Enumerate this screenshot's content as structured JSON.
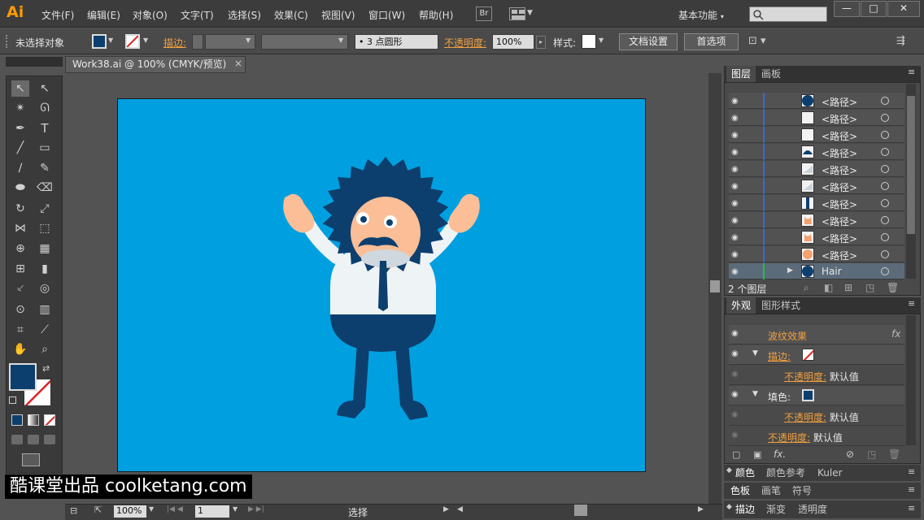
{
  "app": {
    "logo": "Ai"
  },
  "menu": [
    "文件(F)",
    "编辑(E)",
    "对象(O)",
    "文字(T)",
    "选择(S)",
    "效果(C)",
    "视图(V)",
    "窗口(W)",
    "帮助(H)"
  ],
  "bridge_button": "Br",
  "workspace": "基本功能",
  "window_controls": {
    "minimize": "—",
    "maximize": "□",
    "close": "✕"
  },
  "control_bar": {
    "selection_label": "未选择对象",
    "stroke_label": "描边:",
    "brush_value": "3 点圆形",
    "opacity_label": "不透明度:",
    "opacity_value": "100%",
    "style_label": "样式:",
    "doc_setup_button": "文档设置",
    "preferences_button": "首选项"
  },
  "document": {
    "tab_title": "Work38.ai @ 100% (CMYK/预览)",
    "close": "×"
  },
  "status": {
    "zoom": "100%",
    "page": "1",
    "tool": "选择"
  },
  "watermark": "酷课堂出品 coolketang.com",
  "layers_panel": {
    "tabs": [
      "图层",
      "画板"
    ],
    "rows": [
      {
        "name": "<路径>",
        "thumb": "navy-circle"
      },
      {
        "name": "<路径>",
        "thumb": "white"
      },
      {
        "name": "<路径>",
        "thumb": "white"
      },
      {
        "name": "<路径>",
        "thumb": "navy-dome"
      },
      {
        "name": "<路径>",
        "thumb": "white-curve"
      },
      {
        "name": "<路径>",
        "thumb": "white-curve"
      },
      {
        "name": "<路径>",
        "thumb": "tie"
      },
      {
        "name": "<路径>",
        "thumb": "hand"
      },
      {
        "name": "<路径>",
        "thumb": "hand"
      },
      {
        "name": "<路径>",
        "thumb": "skin"
      },
      {
        "name": "Hair",
        "thumb": "navy-circle"
      }
    ],
    "count": "2 个图层"
  },
  "appearance_panel": {
    "tabs": [
      "外观",
      "图形样式"
    ],
    "effect": "波纹效果",
    "fx": "fx",
    "stroke_label": "描边:",
    "stroke_opacity_label": "不透明度:",
    "stroke_opacity_value": "默认值",
    "fill_label": "填色:",
    "fill_opacity_label": "不透明度:",
    "fill_opacity_value": "默认值",
    "opacity_label": "不透明度:",
    "opacity_value": "默认值"
  },
  "color_panels": [
    {
      "tabs": [
        "颜色",
        "颜色参考",
        "Kuler"
      ]
    },
    {
      "tabs": [
        "色板",
        "画笔",
        "符号"
      ]
    },
    {
      "tabs": [
        "描边",
        "渐变",
        "透明度"
      ]
    }
  ],
  "colors": {
    "artboard": "#00a0e0",
    "navy": "#0d3f6e",
    "skin": "#fbbe96",
    "shirt": "#eef3f6",
    "accent": "#f0a040"
  }
}
